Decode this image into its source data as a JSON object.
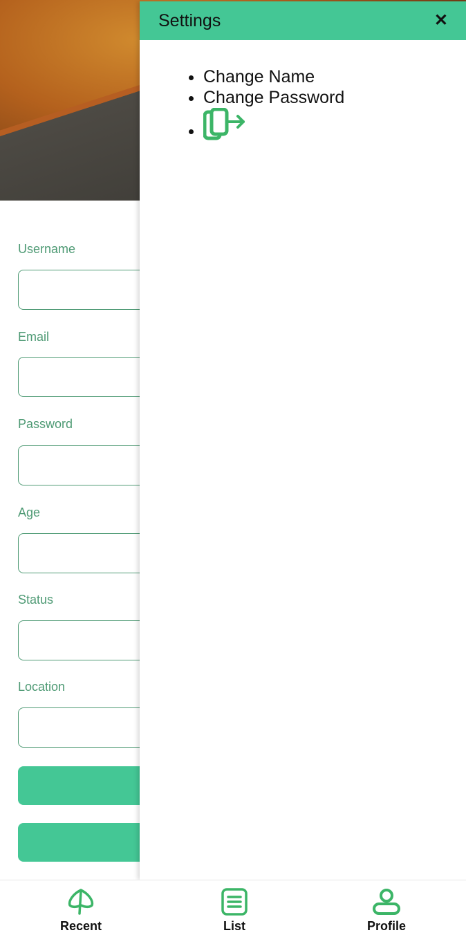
{
  "form": {
    "labels": {
      "username": "Username",
      "email": "Email",
      "password": "Password",
      "age": "Age",
      "status": "Status",
      "location": "Location"
    },
    "values": {
      "username": "",
      "email": "",
      "password": "",
      "age": "",
      "status": "",
      "location": ""
    }
  },
  "drawer": {
    "title": "Settings",
    "close_icon": "close-icon",
    "items": [
      {
        "label": "Change Name"
      },
      {
        "label": "Change Password"
      },
      {
        "icon": "logout-icon"
      }
    ]
  },
  "bottom_nav": {
    "items": [
      {
        "label": "Recent",
        "icon": "leaf-icon"
      },
      {
        "label": "List",
        "icon": "list-icon"
      },
      {
        "label": "Profile",
        "icon": "user-icon"
      }
    ]
  },
  "colors": {
    "accent": "#44c795",
    "label": "#4e9a74",
    "icon_green": "#3cb567"
  }
}
